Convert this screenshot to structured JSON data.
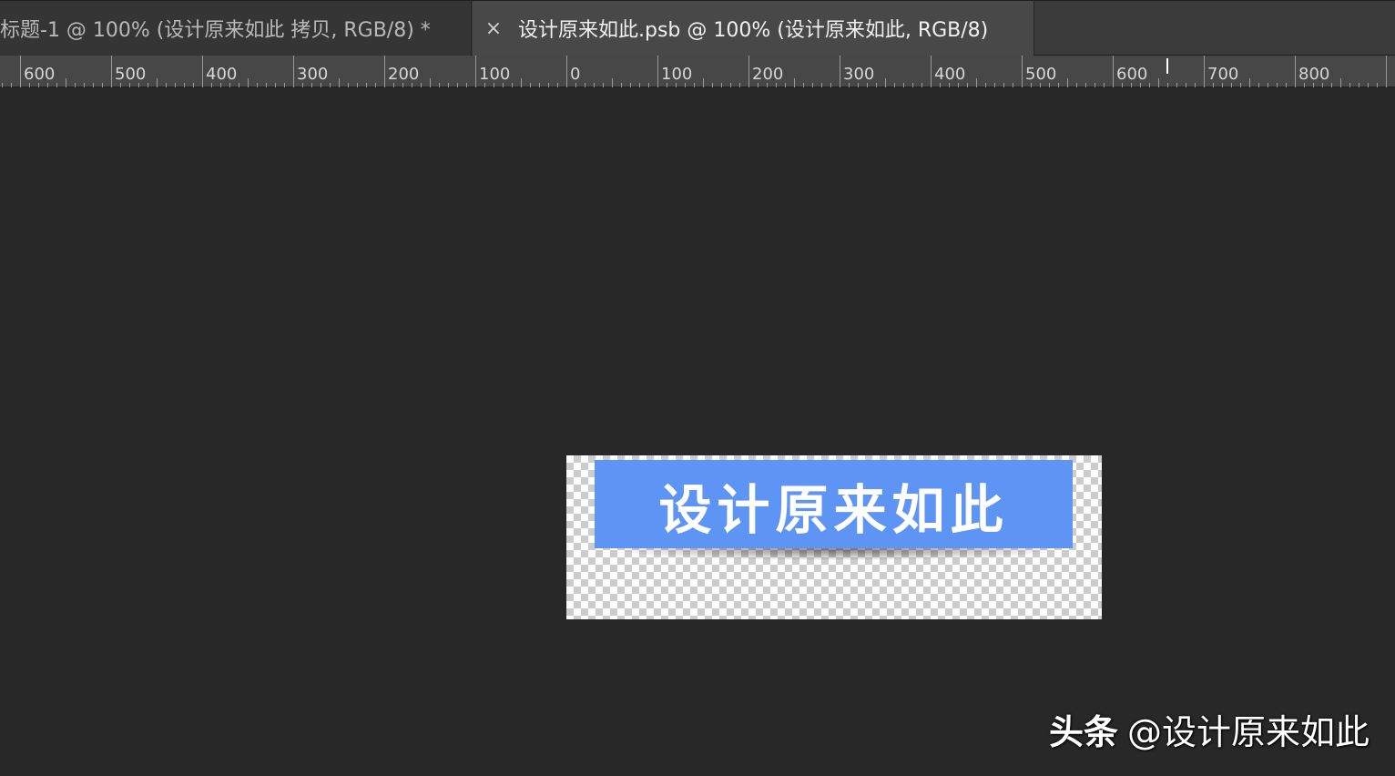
{
  "tabs": [
    {
      "label": "标题-1 @ 100% (设计原来如此 拷贝, RGB/8) *",
      "close": "",
      "active": false
    },
    {
      "label": "设计原来如此.psb @ 100% (设计原来如此, RGB/8)",
      "close": "×",
      "active": true
    }
  ],
  "ruler": {
    "labels": [
      "600",
      "500",
      "400",
      "300",
      "200",
      "100",
      "0",
      "100",
      "200",
      "300",
      "400",
      "500",
      "600",
      "700",
      "800"
    ],
    "unit_step": 100
  },
  "canvas": {
    "banner_text": "设计原来如此",
    "banner_color": "#5e95f4"
  },
  "watermark": {
    "brand": "头条",
    "handle": "@设计原来如此"
  },
  "colors": {
    "workspace": "#282828",
    "tabbar": "#3b3b3b",
    "ruler": "#474747"
  }
}
